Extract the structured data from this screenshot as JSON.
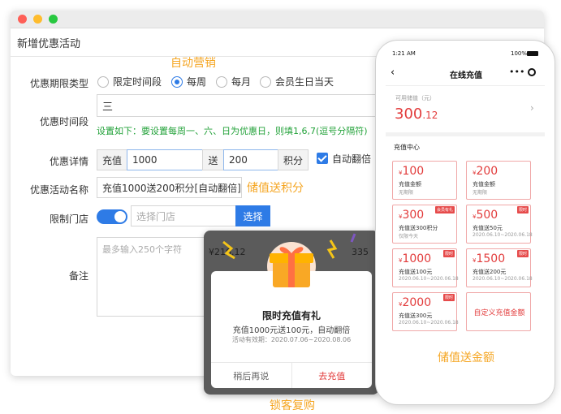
{
  "window": {
    "title": "新增优惠活动",
    "tag_auto_marketing": "自动营销",
    "tag_points": "储值送积分",
    "period_type": {
      "label": "优惠期限类型",
      "options": [
        "限定时间段",
        "每周",
        "每月",
        "会员生日当天"
      ],
      "selected": "每周"
    },
    "period_time": {
      "label": "优惠时间段",
      "value": "三",
      "note": "设置如下：要设置每周一、六、日为优惠日，则填1,6,7(逗号分隔符)"
    },
    "detail": {
      "label": "优惠详情",
      "prefix": "充值",
      "recharge_value": "1000",
      "mid": "送",
      "bonus_value": "200",
      "suffix": "积分",
      "auto_double_label": "自动翻倍"
    },
    "activity_name": {
      "label": "优惠活动名称",
      "value": "充值1000送200积分[自动翻倍]"
    },
    "store": {
      "label": "限制门店",
      "placeholder": "选择门店",
      "button": "选择"
    },
    "remark": {
      "label": "备注",
      "placeholder": "最多输入250个字符"
    }
  },
  "popup": {
    "title": "限时充值有礼",
    "subtitle": "充值1000元送100元，自动翻倍",
    "date": "活动有效期：2020.07.06~2020.08.06",
    "later": "稍后再说",
    "go": "去充值",
    "under_left": "¥216.12",
    "under_right": "335",
    "caption": "锁客复购"
  },
  "phone": {
    "time": "1:21 AM",
    "battery": "100%",
    "nav_title": "在线充值",
    "balance_label": "可用储值（元）",
    "balance_int": "300",
    "balance_dec": ".12",
    "section_title": "充值中心",
    "cards": [
      {
        "amount": "100",
        "line1": "充值金额",
        "line2": "无期限",
        "badge": ""
      },
      {
        "amount": "200",
        "line1": "充值金额",
        "line2": "无期限",
        "badge": ""
      },
      {
        "amount": "300",
        "line1": "充值送300积分",
        "line2": "仅限今天",
        "badge": "会员有礼"
      },
      {
        "amount": "500",
        "line1": "充值送50元",
        "line2": "2020.06.10~2020.06.18",
        "badge": "限时"
      },
      {
        "amount": "1000",
        "line1": "充值送100元",
        "line2": "2020.06.10~2020.06.18",
        "badge": "限时"
      },
      {
        "amount": "1500",
        "line1": "充值送200元",
        "line2": "2020.06.10~2020.06.18",
        "badge": "限时"
      },
      {
        "amount": "2000",
        "line1": "充值送300元",
        "line2": "2020.06.10~2020.06.18",
        "badge": "限时"
      }
    ],
    "custom_card": "自定义充值金额",
    "caption": "储值送金额"
  },
  "colors": {
    "accent_blue": "#2e7be6",
    "orange": "#f5a623",
    "red": "#e23b3b",
    "green_note": "#23a23a"
  }
}
